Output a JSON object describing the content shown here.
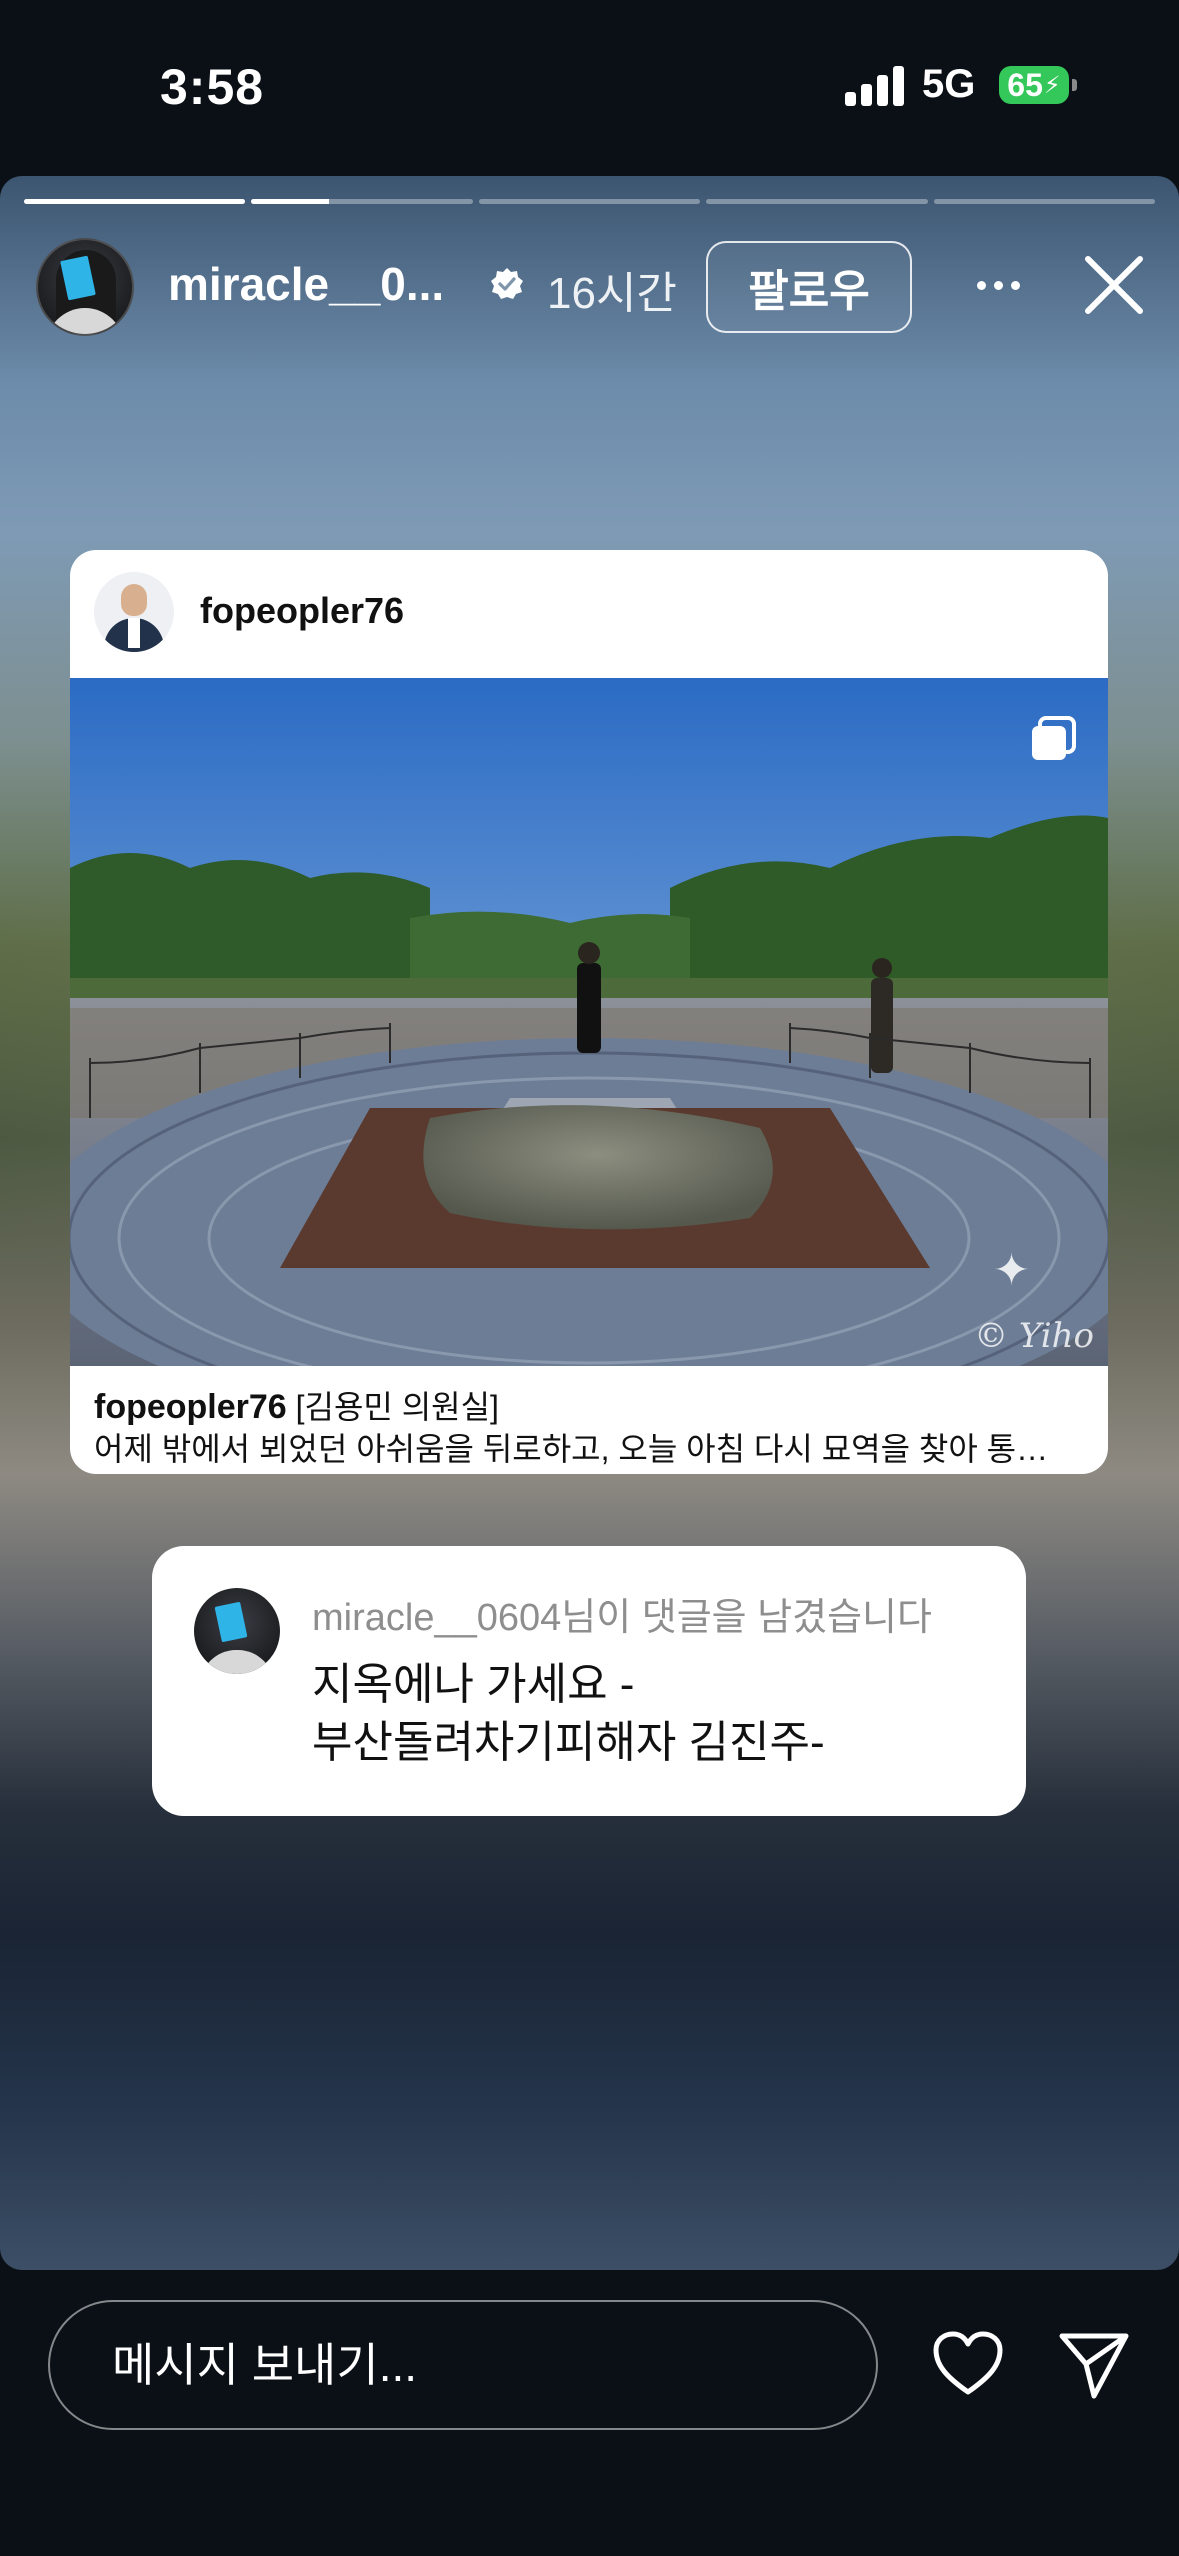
{
  "status_bar": {
    "time": "3:58",
    "network": "5G",
    "battery": "65",
    "battery_color": "#34c759"
  },
  "story": {
    "progress_segments": 5,
    "active_segment": 2,
    "active_segment_progress": 0.35,
    "header": {
      "username": "miracle__0...",
      "verified_icon": "verified-badge-icon",
      "time_ago": "16시간",
      "follow_label": "팔로우",
      "more_icon": "more-dots-icon",
      "close_icon": "close-icon"
    },
    "shared_post": {
      "author": "fopeopler76",
      "caption_author": "fopeopler76",
      "caption_tag": "[김용민 의원실]",
      "caption_text": "어제 밖에서 뵈었던 아쉬움을 뒤로하고, 오늘 아침 다시 묘역을 찾아 통…",
      "multi_image_icon": "multiple-images-icon",
      "watermark": "© Yiho"
    },
    "reply": {
      "meta": "miracle__0604님이 댓글을 남겼습니다",
      "line1": "지옥에나 가세요 -",
      "line2": "부산돌려차기피해자 김진주-"
    }
  },
  "bottom_bar": {
    "message_placeholder": "메시지 보내기...",
    "like_icon": "heart-icon",
    "share_icon": "send-icon"
  }
}
